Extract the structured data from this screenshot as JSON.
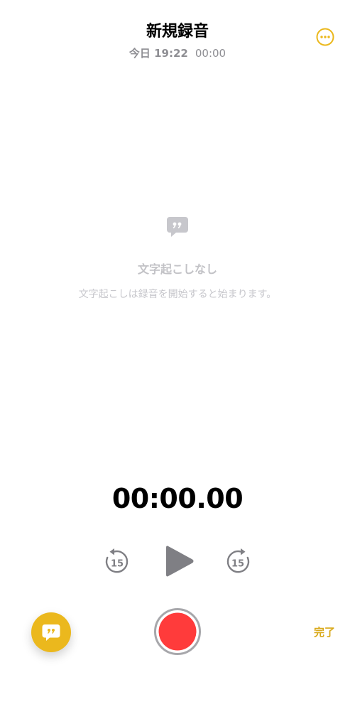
{
  "header": {
    "title": "新規録音",
    "date": "今日 19:22",
    "duration": "00:00"
  },
  "transcript": {
    "empty_title": "文字起こしなし",
    "empty_message": "文字起こしは録音を開始すると始まります。"
  },
  "player": {
    "elapsed": "00:00.00",
    "skip_back_seconds": "15",
    "skip_forward_seconds": "15"
  },
  "footer": {
    "done_label": "完了"
  },
  "icons": {
    "more": "ellipsis-circle-icon",
    "transcript_placeholder": "quote-bubble-icon",
    "skip_back": "gobackward-15-icon",
    "play": "play-icon",
    "skip_forward": "goforward-15-icon",
    "transcript_toggle": "quote-bubble-icon",
    "record": "record-icon"
  },
  "colors": {
    "accent": "#ebb81d",
    "record": "#ff3b3b",
    "secondary_text": "#8e8e93",
    "placeholder_text": "#c7c7cc"
  }
}
